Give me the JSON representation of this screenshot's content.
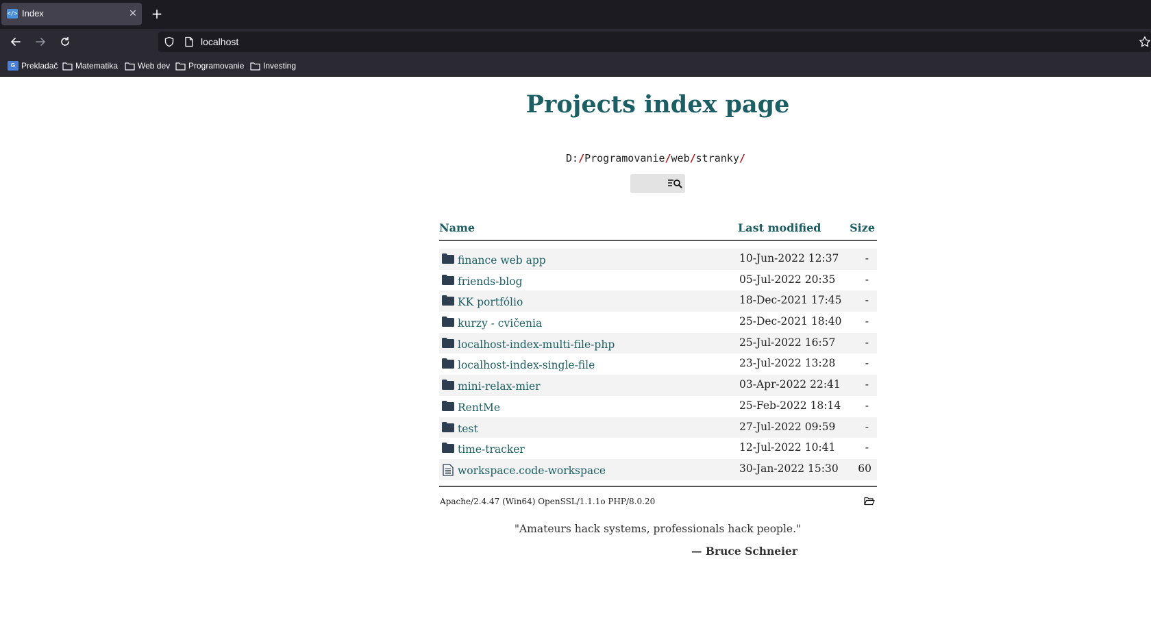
{
  "browser": {
    "tab": {
      "title": "Index",
      "favicon_text": "</>"
    },
    "url": "localhost",
    "bookmarks": [
      {
        "label": "Prekladač",
        "icon": "google-translate-icon"
      },
      {
        "label": "Matematika",
        "icon": "folder-icon"
      },
      {
        "label": "Web dev",
        "icon": "folder-icon"
      },
      {
        "label": "Programovanie",
        "icon": "folder-icon"
      },
      {
        "label": "Investing",
        "icon": "folder-icon"
      }
    ]
  },
  "page": {
    "title": "Projects index page",
    "path": [
      "D:",
      "Programovanie",
      "web",
      "stranky"
    ],
    "path_separator": "/",
    "table": {
      "headers": {
        "name": "Name",
        "modified": "Last modified",
        "size": "Size"
      },
      "rows": [
        {
          "name": "finance web app",
          "modified": "10-Jun-2022 12:37",
          "size": "-",
          "type": "folder"
        },
        {
          "name": "friends-blog",
          "modified": "05-Jul-2022 20:35",
          "size": "-",
          "type": "folder"
        },
        {
          "name": "KK portfólio",
          "modified": "18-Dec-2021 17:45",
          "size": "-",
          "type": "folder"
        },
        {
          "name": "kurzy - cvičenia",
          "modified": "25-Dec-2021 18:40",
          "size": "-",
          "type": "folder"
        },
        {
          "name": "localhost-index-multi-file-php",
          "modified": "25-Jul-2022 16:57",
          "size": "-",
          "type": "folder"
        },
        {
          "name": "localhost-index-single-file",
          "modified": "23-Jul-2022 13:28",
          "size": "-",
          "type": "folder"
        },
        {
          "name": "mini-relax-mier",
          "modified": "03-Apr-2022 22:41",
          "size": "-",
          "type": "folder"
        },
        {
          "name": "RentMe",
          "modified": "25-Feb-2022 18:14",
          "size": "-",
          "type": "folder"
        },
        {
          "name": "test",
          "modified": "27-Jul-2022 09:59",
          "size": "-",
          "type": "folder"
        },
        {
          "name": "time-tracker",
          "modified": "12-Jul-2022 10:41",
          "size": "-",
          "type": "folder"
        },
        {
          "name": "workspace.code-workspace",
          "modified": "30-Jan-2022 15:30",
          "size": "60",
          "type": "file"
        }
      ]
    },
    "server": "Apache/2.4.47 (Win64) OpenSSL/1.1.1o PHP/8.0.20",
    "quote": "\"Amateurs hack systems, professionals hack people.\"",
    "author": "— Bruce Schneier"
  },
  "colors": {
    "accent": "#1b5e63",
    "separator": "#b01414",
    "folder": "#2c3e50",
    "chrome_dark": "#1c1b22",
    "chrome_mid": "#2b2a33"
  }
}
